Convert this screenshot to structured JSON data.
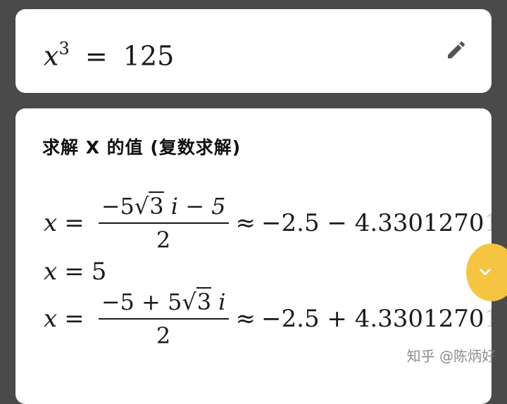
{
  "equation": {
    "base": "x",
    "exponent": "3",
    "equals": "=",
    "rhs": "125"
  },
  "edit": {
    "icon": "pencil-icon"
  },
  "result": {
    "title": "求解 X 的值 (复数求解)",
    "solutions": [
      {
        "lhs": "x",
        "eq": "=",
        "num_a": "−5",
        "num_sqrt": "3",
        "num_b": "i − 5",
        "den": "2",
        "approx": "≈",
        "decimal": "−2.5 − 4.3301270",
        "decimal_fade": "1"
      },
      {
        "lhs": "x",
        "eq": "=",
        "value": "5"
      },
      {
        "lhs": "x",
        "eq": "=",
        "num_a": "−5 + 5",
        "num_sqrt": "3",
        "num_b": "i",
        "den": "2",
        "approx": "≈",
        "decimal": "−2.5 + 4.3301270",
        "decimal_fade": "1"
      }
    ]
  },
  "scroll": {
    "icon": "chevron-down-icon",
    "color": "#f5c542"
  },
  "watermark": "知乎 @陈炳好"
}
